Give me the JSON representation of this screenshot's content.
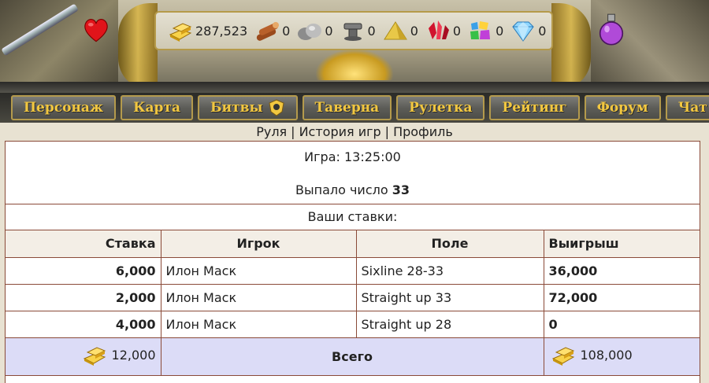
{
  "resources": [
    {
      "icon": "gold-bars-icon",
      "value": "287,523"
    },
    {
      "icon": "wood-logs-icon",
      "value": "0"
    },
    {
      "icon": "stone-icon",
      "value": "0"
    },
    {
      "icon": "iron-icon",
      "value": "0"
    },
    {
      "icon": "sand-icon",
      "value": "0"
    },
    {
      "icon": "ruby-icon",
      "value": "0"
    },
    {
      "icon": "gems-icon",
      "value": "0"
    },
    {
      "icon": "diamond-icon",
      "value": "0"
    }
  ],
  "nav": [
    "Персонаж",
    "Карта",
    "Битвы",
    "Таверна",
    "Рулетка",
    "Рейтинг",
    "Форум",
    "Чат"
  ],
  "sublinks": {
    "roulette": "Руля",
    "history": "История игр",
    "profile": "Профиль",
    "separator": "|"
  },
  "game": {
    "time_label": "Игра: 13:25:00",
    "result_label": "Выпало число",
    "result_number": "33"
  },
  "bets_title": "Ваши ставки:",
  "table": {
    "headers": {
      "bet": "Ставка",
      "player": "Игрок",
      "field": "Поле",
      "win": "Выигрыш"
    },
    "rows": [
      {
        "bet": "6,000",
        "player": "Илон Маск",
        "field": "Sixline 28-33",
        "win": "36,000"
      },
      {
        "bet": "2,000",
        "player": "Илон Маск",
        "field": "Straight up 33",
        "win": "72,000"
      },
      {
        "bet": "4,000",
        "player": "Илон Маск",
        "field": "Straight up 28",
        "win": "0"
      }
    ],
    "total": {
      "bet": "12,000",
      "label": "Всего",
      "win": "108,000"
    }
  },
  "colors": {
    "nav_text": "#f2c740",
    "border": "#8a4a38",
    "total_bg": "#dcdcf7"
  }
}
